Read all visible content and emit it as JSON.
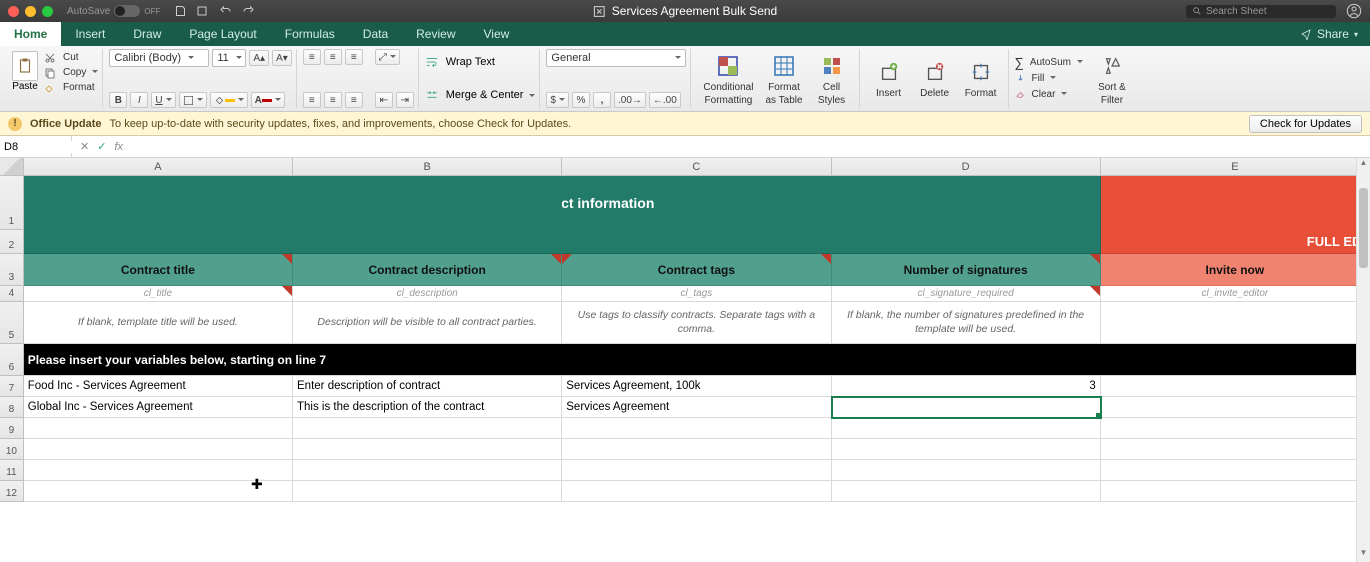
{
  "titlebar": {
    "autosave_label": "AutoSave",
    "autosave_state": "OFF",
    "doc_title": "Services Agreement Bulk Send",
    "search_placeholder": "Search Sheet"
  },
  "tabs": {
    "items": [
      "Home",
      "Insert",
      "Draw",
      "Page Layout",
      "Formulas",
      "Data",
      "Review",
      "View"
    ],
    "share": "Share"
  },
  "ribbon": {
    "paste": "Paste",
    "cut": "Cut",
    "copy": "Copy",
    "format_painter": "Format",
    "font_name": "Calibri (Body)",
    "font_size": "11",
    "wrap_text": "Wrap Text",
    "merge_center": "Merge & Center",
    "number_format": "General",
    "cond_fmt": "Conditional",
    "cond_fmt2": "Formatting",
    "format_table": "Format",
    "format_table2": "as Table",
    "cell_styles": "Cell",
    "cell_styles2": "Styles",
    "insert": "Insert",
    "delete": "Delete",
    "format": "Format",
    "autosum": "AutoSum",
    "fill": "Fill",
    "clear": "Clear",
    "sort_filter": "Sort &",
    "sort_filter2": "Filter"
  },
  "msgbar": {
    "title": "Office Update",
    "body": "To keep up-to-date with security updates, fixes, and improvements, choose Check for Updates.",
    "button": "Check for Updates"
  },
  "formula": {
    "namebox": "D8",
    "fx": "fx"
  },
  "columns": [
    "A",
    "B",
    "C",
    "D",
    "E"
  ],
  "sheet": {
    "header_main": "General contract information",
    "header_right": "FULL EDI",
    "subheaders": {
      "A": "Contract title",
      "B": "Contract description",
      "C": "Contract tags",
      "D": "Number of signatures",
      "E": "Invite now"
    },
    "notes": {
      "A": "cl_title",
      "B": "cl_description",
      "C": "cl_tags",
      "D": "cl_signature_required",
      "E": "cl_invite_editor"
    },
    "hints": {
      "A": "If blank, template title will be used.",
      "B": "Description will be visible to all contract parties.",
      "C": "Use tags to classify contracts. Separate tags with a comma.",
      "D": "If blank, the number of signatures predefined in the template will be used.",
      "E": ""
    },
    "black_banner": "Please insert your variables below, starting on line 7",
    "rows": [
      {
        "A": "Food Inc - Services Agreement",
        "B": "Enter description of contract",
        "C": "Services Agreement, 100k",
        "D": "3",
        "E": ""
      },
      {
        "A": "Global Inc - Services Agreement",
        "B": "This is the description of the contract",
        "C": "Services Agreement",
        "D": "",
        "E": ""
      }
    ]
  }
}
